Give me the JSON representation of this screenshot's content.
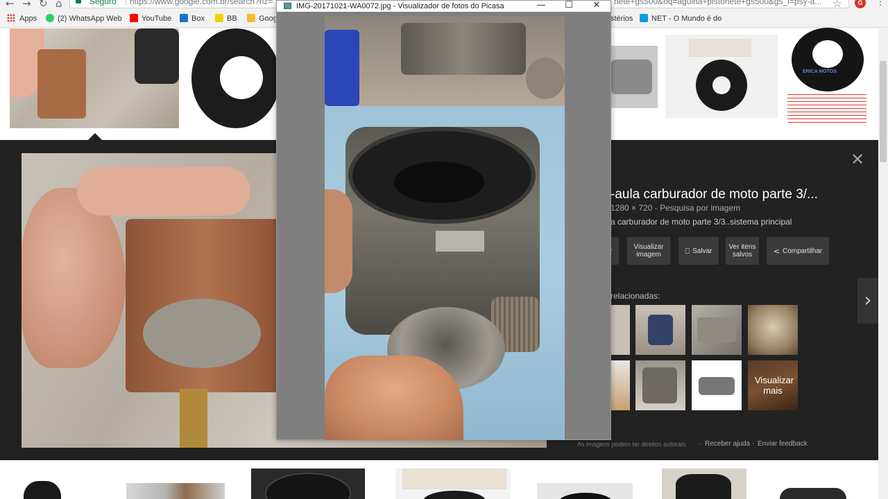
{
  "browser": {
    "secure_label": "Seguro",
    "url": "https://www.google.com.br/search?rlz=",
    "url_tail": "nete+gs500&oq=agulha+pistonete+gs500&gs_l=psy-a...",
    "badge_icon_label": "G",
    "icons": {
      "back": "arrow-left-icon",
      "forward": "arrow-right-icon",
      "reload": "reload-icon",
      "home": "home-icon",
      "star": "star-icon",
      "menu": "kebab-menu-icon"
    }
  },
  "bookmarks": [
    {
      "label": "Apps",
      "icon": "apps-grid-icon",
      "color": "#db4437"
    },
    {
      "label": "(2) WhatsApp Web",
      "icon": "whatsapp-icon",
      "color": "#25d366"
    },
    {
      "label": "YouTube",
      "icon": "youtube-icon",
      "color": "#ff0000"
    },
    {
      "label": "Box",
      "icon": "box-icon",
      "color": "#1a73c8"
    },
    {
      "label": "BB",
      "icon": "bb-icon",
      "color": "#f5d000"
    },
    {
      "label": "Goog",
      "icon": "google-icon",
      "color": "#f9bb2d"
    },
    {
      "label": "stérios",
      "icon": "",
      "color": ""
    },
    {
      "label": "NET - O Mundo é do",
      "icon": "net-icon",
      "color": "#00a0e0"
    }
  ],
  "thumbnail_logo": "ERICA MOTOS",
  "preview": {
    "title": "-aula carburador de moto parte 3/...",
    "meta_size": "1280 × 720",
    "meta_separator": "-",
    "meta_link": "Pesquisa por imagem",
    "description": "a carburador de moto parte 3/3..sistema principal",
    "actions": [
      {
        "label": "r",
        "icon": ""
      },
      {
        "label": "Visualizar imagem",
        "icon": ""
      },
      {
        "label": "Salvar",
        "icon": "bookmark-icon"
      },
      {
        "label": "Ver itens salvos",
        "icon": ""
      },
      {
        "label": "Compartilhar",
        "icon": "share-icon"
      }
    ],
    "related_label": "relacionadas:",
    "more_label": "Visualizar mais",
    "footer_note": "As imagens podem ter direitos autorais.",
    "footer_help": "Receber ajuda",
    "footer_feedback": "Enviar feedback"
  },
  "picasa": {
    "title": "IMG-20171021-WA0072.jpg - Visualizador de fotos do Picasa",
    "minimize_glyph": "—",
    "maximize_glyph": "☐",
    "close_glyph": "✕"
  },
  "colors": {
    "panel_bg": "#222222",
    "secure_green": "#0b8043",
    "picasa_bg": "#7f7f7f"
  }
}
